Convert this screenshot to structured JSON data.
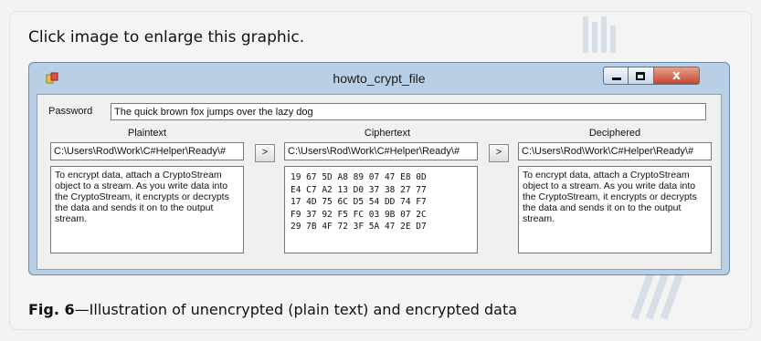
{
  "article": {
    "top_caption": "Click image to enlarge this graphic.",
    "figure_number": "Fig. 6",
    "figure_text": "—Illustration of unencrypted (plain text) and encrypted data"
  },
  "window": {
    "title": "howto_crypt_file",
    "minimize_icon": "minimize-icon",
    "maximize_icon": "maximize-icon",
    "close_label": "x"
  },
  "form": {
    "password_label": "Password",
    "password_value": "The quick brown fox jumps over the lazy dog",
    "columns": [
      {
        "header": "Plaintext",
        "path": "C:\\Users\\Rod\\Work\\C#Helper\\Ready\\#",
        "content": "To encrypt data, attach a CryptoStream object to a stream. As you write data into the CryptoStream, it encrypts or decrypts the data and sends it on to the output stream."
      },
      {
        "header": "Ciphertext",
        "path": "C:\\Users\\Rod\\Work\\C#Helper\\Ready\\#",
        "content": "19 67 5D A8 89 07 47 E8 0D\nE4 C7 A2 13 D0 37 38 27 77\n17 4D 75 6C D5 54 DD 74 F7\nF9 37 92 F5 FC 03 9B 07 2C\n29 7B 4F 72 3F 5A 47 2E D7"
      },
      {
        "header": "Deciphered",
        "path": "C:\\Users\\Rod\\Work\\C#Helper\\Ready\\#",
        "content": "To encrypt data, attach a CryptoStream object to a stream. As you write data into the CryptoStream, it encrypts or decrypts the data and sends it on to the output stream."
      }
    ],
    "arrow_label": ">"
  }
}
